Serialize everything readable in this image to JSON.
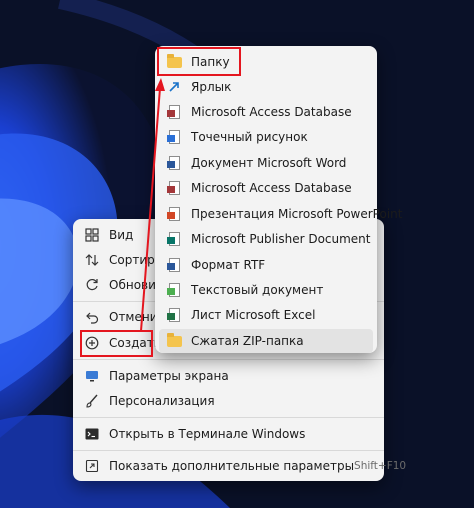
{
  "context_menu": {
    "items": [
      {
        "label": "Вид",
        "icon": "grid-icon"
      },
      {
        "label": "Сортиров",
        "icon": "sort-icon"
      },
      {
        "label": "Обновить",
        "icon": "refresh-icon"
      },
      {
        "label": "Отменит",
        "icon": "undo-icon"
      },
      {
        "label": "Создать",
        "icon": "new-icon"
      },
      {
        "label": "Параметры экрана",
        "icon": "display-icon"
      },
      {
        "label": "Персонализация",
        "icon": "brush-icon"
      },
      {
        "label": "Открыть в Терминале Windows",
        "icon": "terminal-icon"
      },
      {
        "label": "Показать дополнительные параметры",
        "icon": "more-icon",
        "shortcut": "Shift+F10"
      }
    ]
  },
  "submenu": {
    "items": [
      {
        "label": "Папку",
        "icon": "folder-icon"
      },
      {
        "label": "Ярлык",
        "icon": "shortcut-icon"
      },
      {
        "label": "Microsoft Access Database",
        "icon": "access-icon"
      },
      {
        "label": "Точечный рисунок",
        "icon": "bitmap-icon"
      },
      {
        "label": "Документ Microsoft Word",
        "icon": "word-icon"
      },
      {
        "label": "Microsoft Access Database",
        "icon": "access-icon"
      },
      {
        "label": "Презентация Microsoft PowerPoint",
        "icon": "powerpoint-icon"
      },
      {
        "label": "Microsoft Publisher Document",
        "icon": "publisher-icon"
      },
      {
        "label": "Формат RTF",
        "icon": "rtf-icon"
      },
      {
        "label": "Текстовый документ",
        "icon": "text-icon"
      },
      {
        "label": "Лист Microsoft Excel",
        "icon": "excel-icon"
      },
      {
        "label": "Сжатая ZIP-папка",
        "icon": "zip-folder-icon"
      }
    ]
  },
  "colors": {
    "highlight_box": "#e4161f",
    "menu_background": "#f3f3f3",
    "wallpaper": "#0b1230"
  }
}
